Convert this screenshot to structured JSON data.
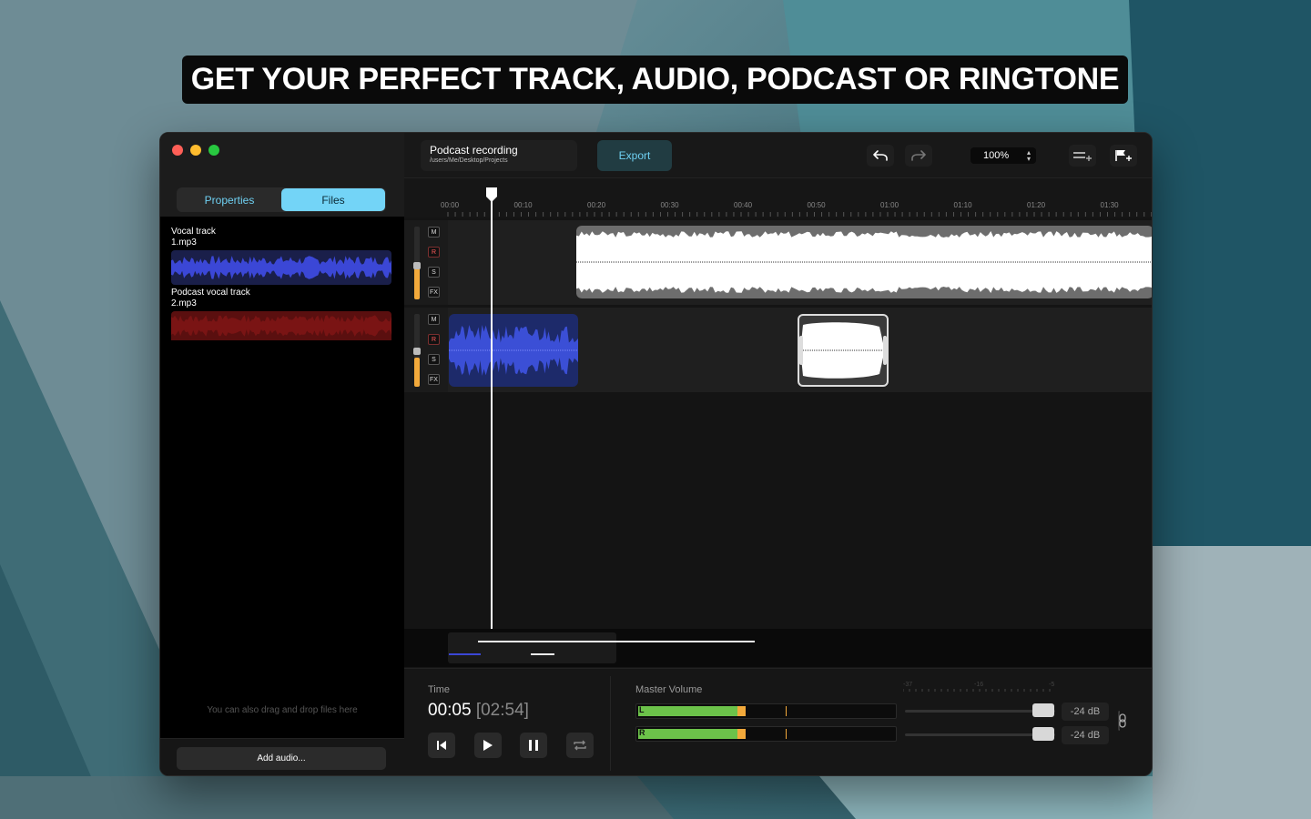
{
  "headline": "GET YOUR PERFECT TRACK, AUDIO, PODCAST OR RINGTONE",
  "sidebar": {
    "tabs": [
      {
        "label": "Properties",
        "active": false
      },
      {
        "label": "Files",
        "active": true
      }
    ],
    "files": [
      {
        "name": "Vocal track\n1.mp3",
        "wave_color": "#3b47d6"
      },
      {
        "name": "Podcast vocal track\n2.mp3",
        "wave_color": "#7a1414"
      }
    ],
    "drop_hint": "You can also drag and drop files here",
    "add_button": "Add audio..."
  },
  "toolbar": {
    "project_title": "Podcast recording",
    "project_path": "/users/Me/Desktop/Projects",
    "export_label": "Export",
    "zoom_value": "100%",
    "icons": [
      "undo-icon",
      "redo-icon",
      "add-track-icon",
      "add-marker-icon"
    ]
  },
  "timeline": {
    "ticks": [
      "00:00",
      "00:10",
      "00:20",
      "00:30",
      "00:40",
      "00:50",
      "01:00",
      "01:10",
      "01:20",
      "01:30"
    ]
  },
  "tracks": [
    {
      "buttons": [
        "M",
        "R",
        "S",
        "FX"
      ],
      "fader_level": 0.45
    },
    {
      "buttons": [
        "M",
        "R",
        "S",
        "FX"
      ],
      "fader_level": 0.4
    }
  ],
  "transport": {
    "time_label": "Time",
    "current_time": "00:05",
    "total_time": "[02:54]"
  },
  "master": {
    "label": "Master Volume",
    "channels": [
      {
        "name": "L",
        "level": 0.41,
        "db": "-24 dB"
      },
      {
        "name": "R",
        "level": 0.41,
        "db": "-24 dB"
      }
    ],
    "scale": [
      "-37",
      "-16",
      "-5"
    ]
  },
  "colors": {
    "accent": "#73d4f7",
    "meter_green": "#6cc24a",
    "meter_orange": "#f2a93b",
    "wave_blue": "#3b47d6",
    "wave_red": "#7a1414"
  }
}
